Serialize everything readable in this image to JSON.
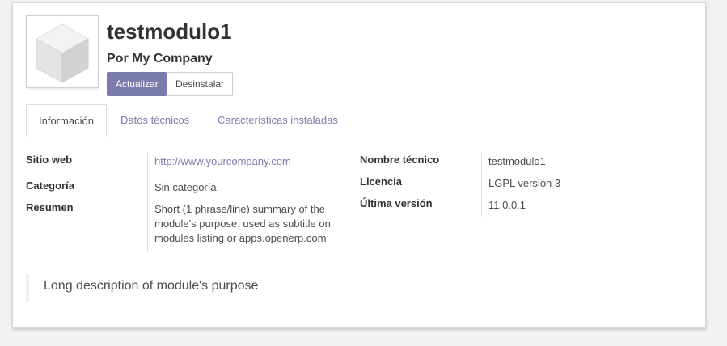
{
  "module": {
    "name": "testmodulo1",
    "author": "Por My Company",
    "icon": "module-cube-icon"
  },
  "buttons": {
    "upgrade": "Actualizar",
    "uninstall": "Desinstalar"
  },
  "tabs": [
    {
      "label": "Información",
      "active": true
    },
    {
      "label": "Datos técnicos",
      "active": false
    },
    {
      "label": "Características instaladas",
      "active": false
    }
  ],
  "info": {
    "website_label": "Sitio web",
    "website_value": "http://www.yourcompany.com",
    "category_label": "Categoría",
    "category_value": "Sin categoría",
    "summary_label": "Resumen",
    "summary_line1": "Short (1 phrase/line) summary of the",
    "summary_line2": "module's purpose, used as subtitle on",
    "summary_line3": "modules listing or apps.openerp.com",
    "technical_name_label": "Nombre técnico",
    "technical_name_value": "testmodulo1",
    "license_label": "Licencia",
    "license_value": "LGPL versión 3",
    "version_label": "Última versión",
    "version_value": "11.0.0.1"
  },
  "description": "Long description of module's purpose",
  "colors": {
    "accent": "#7c7bad",
    "text": "#4c4c4c",
    "background": "#f2f2f2"
  }
}
